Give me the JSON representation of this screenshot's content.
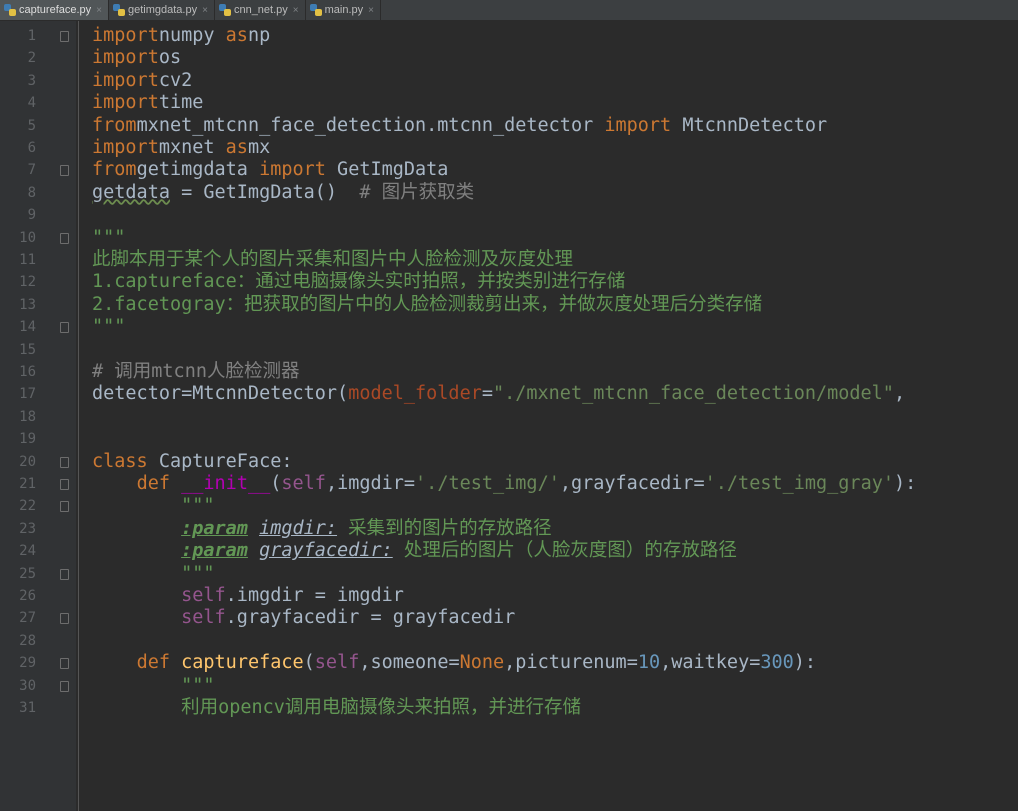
{
  "tabs": [
    {
      "label": "captureface.py",
      "active": true
    },
    {
      "label": "getimgdata.py",
      "active": false
    },
    {
      "label": "cnn_net.py",
      "active": false
    },
    {
      "label": "main.py",
      "active": false
    }
  ],
  "lines": [
    {
      "n": "1",
      "parts": [
        [
          "kw",
          "import"
        ],
        [
          "",
          "numpy "
        ],
        [
          "kw",
          "as"
        ],
        [
          "",
          "np"
        ]
      ]
    },
    {
      "n": "2",
      "parts": [
        [
          "kw",
          "import"
        ],
        [
          "",
          "os"
        ]
      ]
    },
    {
      "n": "3",
      "parts": [
        [
          "kw",
          "import"
        ],
        [
          "",
          "cv2"
        ]
      ]
    },
    {
      "n": "4",
      "parts": [
        [
          "kw",
          "import"
        ],
        [
          "",
          "time"
        ]
      ]
    },
    {
      "n": "5",
      "parts": [
        [
          "kw",
          "from"
        ],
        [
          "",
          "mxnet_mtcnn_face_detection.mtcnn_detector "
        ],
        [
          "kw",
          "import"
        ],
        [
          "",
          " MtcnnDetector"
        ]
      ]
    },
    {
      "n": "6",
      "parts": [
        [
          "kw",
          "import"
        ],
        [
          "",
          "mxnet "
        ],
        [
          "kw",
          "as"
        ],
        [
          "",
          "mx"
        ]
      ]
    },
    {
      "n": "7",
      "parts": [
        [
          "kw",
          "from"
        ],
        [
          "",
          "getimgdata "
        ],
        [
          "kw",
          "import"
        ],
        [
          "",
          " GetImgData"
        ]
      ]
    },
    {
      "n": "8",
      "parts": [
        [
          "sq",
          "getdata"
        ],
        [
          "",
          " = GetImgData()  "
        ],
        [
          "cmt",
          "# 图片获取类"
        ]
      ]
    },
    {
      "n": "9",
      "parts": []
    },
    {
      "n": "10",
      "parts": [
        [
          "doc",
          "\"\"\""
        ]
      ]
    },
    {
      "n": "11",
      "parts": [
        [
          "doc",
          "此脚本用于某个人的图片采集和图片中人脸检测及灰度处理"
        ]
      ]
    },
    {
      "n": "12",
      "parts": [
        [
          "doc",
          "1.captureface：通过电脑摄像头实时拍照，并按类别进行存储"
        ]
      ]
    },
    {
      "n": "13",
      "parts": [
        [
          "doc",
          "2.facetogray：把获取的图片中的人脸检测裁剪出来，并做灰度处理后分类存储"
        ]
      ]
    },
    {
      "n": "14",
      "parts": [
        [
          "doc",
          "\"\"\""
        ]
      ]
    },
    {
      "n": "15",
      "parts": []
    },
    {
      "n": "16",
      "parts": [
        [
          "cmt",
          "# 调用mtcnn人脸检测器"
        ]
      ]
    },
    {
      "n": "17",
      "parts": [
        [
          "",
          "detector=MtcnnDetector("
        ],
        [
          "param",
          "model_folder"
        ],
        [
          "",
          "="
        ],
        [
          "str",
          "\"./mxnet_mtcnn_face_detection/model\""
        ],
        [
          "",
          ", "
        ]
      ]
    },
    {
      "n": "18",
      "parts": []
    },
    {
      "n": "19",
      "parts": []
    },
    {
      "n": "20",
      "parts": [
        [
          "kw",
          "class"
        ],
        [
          "",
          " CaptureFace:"
        ]
      ]
    },
    {
      "n": "21",
      "parts": [
        [
          "",
          "    "
        ],
        [
          "kw",
          "def"
        ],
        [
          "",
          " "
        ],
        [
          "dunder",
          "__init__"
        ],
        [
          "",
          "("
        ],
        [
          "self",
          "self"
        ],
        [
          "",
          ",imgdir="
        ],
        [
          "str",
          "'./test_img/'"
        ],
        [
          "",
          ",grayfacedir="
        ],
        [
          "str",
          "'./test_img_gray'"
        ],
        [
          "",
          "):"
        ]
      ]
    },
    {
      "n": "22",
      "parts": [
        [
          "",
          "        "
        ],
        [
          "doc",
          "\"\"\""
        ]
      ]
    },
    {
      "n": "23",
      "parts": [
        [
          "",
          "        "
        ],
        [
          "tag",
          ":param"
        ],
        [
          "",
          " "
        ],
        [
          "ital",
          "imgdir:"
        ],
        [
          "doc",
          " 采集到的图片的存放路径"
        ]
      ]
    },
    {
      "n": "24",
      "parts": [
        [
          "",
          "        "
        ],
        [
          "tag",
          ":param"
        ],
        [
          "",
          " "
        ],
        [
          "ital",
          "grayfacedir:"
        ],
        [
          "doc",
          " 处理后的图片（人脸灰度图）的存放路径"
        ]
      ]
    },
    {
      "n": "25",
      "parts": [
        [
          "",
          "        "
        ],
        [
          "doc",
          "\"\"\""
        ]
      ]
    },
    {
      "n": "26",
      "parts": [
        [
          "",
          "        "
        ],
        [
          "self",
          "self"
        ],
        [
          "",
          ".imgdir = imgdir"
        ]
      ]
    },
    {
      "n": "27",
      "parts": [
        [
          "",
          "        "
        ],
        [
          "self",
          "self"
        ],
        [
          "",
          ".grayfacedir = grayfacedir"
        ]
      ]
    },
    {
      "n": "28",
      "parts": []
    },
    {
      "n": "29",
      "parts": [
        [
          "",
          "    "
        ],
        [
          "kw",
          "def"
        ],
        [
          "",
          " "
        ],
        [
          "fn",
          "captureface"
        ],
        [
          "",
          "("
        ],
        [
          "self",
          "self"
        ],
        [
          "",
          ",someone="
        ],
        [
          "kw",
          "None"
        ],
        [
          "",
          ",picturenum="
        ],
        [
          "num",
          "10"
        ],
        [
          "",
          ",waitkey="
        ],
        [
          "num",
          "300"
        ],
        [
          "",
          "):"
        ]
      ]
    },
    {
      "n": "30",
      "parts": [
        [
          "",
          "        "
        ],
        [
          "doc",
          "\"\"\""
        ]
      ]
    },
    {
      "n": "31",
      "parts": [
        [
          "",
          "        "
        ],
        [
          "doc",
          "利用opencv调用电脑摄像头来拍照，并进行存储"
        ]
      ]
    }
  ],
  "colors": {
    "background": "#2b2b2b",
    "gutter": "#313335",
    "keyword": "#cc7832",
    "string": "#6a8759",
    "comment": "#808080",
    "docstring": "#629755",
    "self": "#94558d",
    "number": "#6897bb",
    "function": "#ffc66d"
  }
}
